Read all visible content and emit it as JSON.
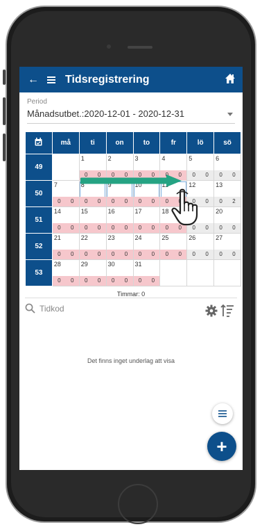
{
  "header": {
    "back_icon": "arrow-left-icon",
    "menu_icon": "hamburger-icon",
    "title": "Tidsregistrering",
    "home_icon": "home-icon"
  },
  "period": {
    "label": "Period",
    "value": "Månadsutbet.:2020-12-01 - 2020-12-31"
  },
  "calendar": {
    "headers": [
      "må",
      "ti",
      "on",
      "to",
      "fr",
      "lö",
      "sö"
    ],
    "weeks": [
      {
        "week": "49",
        "days": [
          {
            "d": "",
            "h": null
          },
          {
            "d": "1",
            "h": [
              "0",
              "0"
            ]
          },
          {
            "d": "2",
            "h": [
              "0",
              "0"
            ]
          },
          {
            "d": "3",
            "h": [
              "0",
              "0"
            ]
          },
          {
            "d": "4",
            "h": [
              "0",
              "0"
            ]
          },
          {
            "d": "5",
            "h": [
              "0",
              "0"
            ]
          },
          {
            "d": "6",
            "h": [
              "0",
              "0"
            ]
          }
        ]
      },
      {
        "week": "50",
        "days": [
          {
            "d": "7",
            "h": [
              "0",
              "0"
            ]
          },
          {
            "d": "8",
            "h": [
              "0",
              "0"
            ]
          },
          {
            "d": "9",
            "h": [
              "0",
              "0"
            ]
          },
          {
            "d": "10",
            "h": [
              "0",
              "0"
            ]
          },
          {
            "d": "11",
            "h": [
              "0",
              "0"
            ]
          },
          {
            "d": "12",
            "h": [
              "0",
              "0"
            ]
          },
          {
            "d": "13",
            "h": [
              "0",
              "2"
            ]
          }
        ]
      },
      {
        "week": "51",
        "days": [
          {
            "d": "14",
            "h": [
              "0",
              "0"
            ]
          },
          {
            "d": "15",
            "h": [
              "0",
              "0"
            ]
          },
          {
            "d": "16",
            "h": [
              "0",
              "0"
            ]
          },
          {
            "d": "17",
            "h": [
              "0",
              "0"
            ]
          },
          {
            "d": "18",
            "h": [
              "0",
              "0"
            ]
          },
          {
            "d": "19",
            "h": [
              "0",
              "0"
            ]
          },
          {
            "d": "20",
            "h": [
              "0",
              "0"
            ]
          }
        ]
      },
      {
        "week": "52",
        "days": [
          {
            "d": "21",
            "h": [
              "0",
              "0"
            ]
          },
          {
            "d": "22",
            "h": [
              "0",
              "0"
            ]
          },
          {
            "d": "23",
            "h": [
              "0",
              "0"
            ]
          },
          {
            "d": "24",
            "h": [
              "0",
              "0"
            ]
          },
          {
            "d": "25",
            "h": [
              "0",
              "0"
            ]
          },
          {
            "d": "26",
            "h": [
              "0",
              "0"
            ]
          },
          {
            "d": "27",
            "h": [
              "0",
              "0"
            ]
          }
        ]
      },
      {
        "week": "53",
        "days": [
          {
            "d": "28",
            "h": [
              "0",
              "0"
            ]
          },
          {
            "d": "29",
            "h": [
              "0",
              "0"
            ]
          },
          {
            "d": "30",
            "h": [
              "0",
              "0"
            ]
          },
          {
            "d": "31",
            "h": [
              "0",
              "0"
            ]
          },
          {
            "d": "",
            "h": null
          },
          {
            "d": "",
            "h": null
          },
          {
            "d": "",
            "h": null
          }
        ]
      }
    ],
    "timmar": "Timmar: 0"
  },
  "search": {
    "placeholder": "Tidkod",
    "search_icon": "search-icon",
    "settings_icon": "gear-icon",
    "sort_icon": "sort-icon"
  },
  "empty_text": "Det finns inget underlag att visa",
  "fab": {
    "list_icon": "list-icon",
    "add_label": "+"
  },
  "colors": {
    "primary": "#0d4f8b",
    "pink": "#f6c7cc",
    "arrow": "#25a383"
  }
}
